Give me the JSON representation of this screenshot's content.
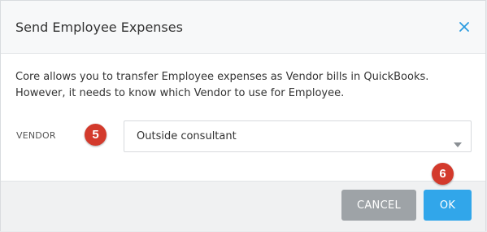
{
  "dialog": {
    "title": "Send Employee Expenses",
    "close_icon": "close-icon",
    "description_line1": "Core allows you to transfer Employee expenses as Vendor bills in QuickBooks.",
    "description_line2": "However, it needs to know which Vendor to use for Employee."
  },
  "vendor": {
    "label": "VENDOR",
    "selected": "Outside consultant",
    "caret_icon": "caret-down-icon"
  },
  "annotations": {
    "step5": "5",
    "step6": "6"
  },
  "footer": {
    "cancel_label": "CANCEL",
    "ok_label": "OK"
  },
  "colors": {
    "accent": "#31a6ea",
    "cancel": "#9ea3a7",
    "badge": "#d33a2c"
  }
}
